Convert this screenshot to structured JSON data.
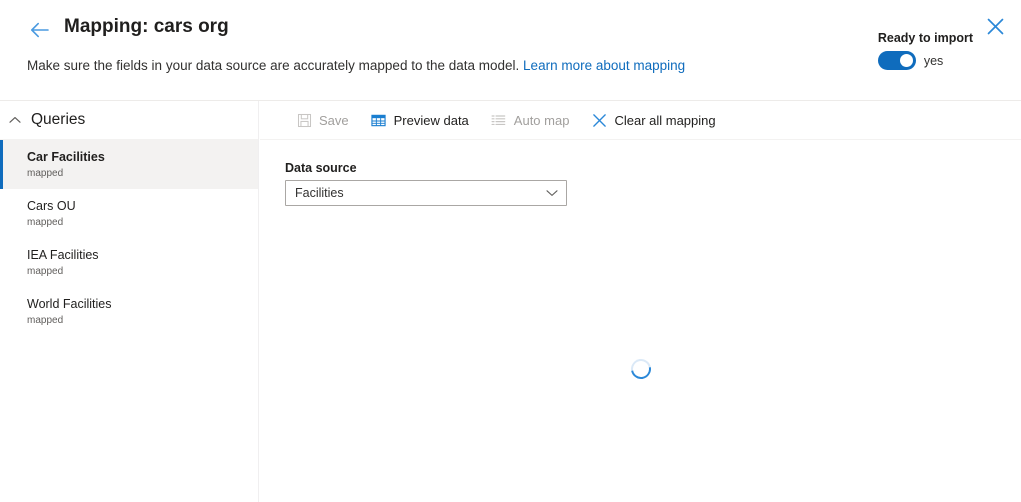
{
  "header": {
    "back_icon": "arrow-left-icon",
    "title": "Mapping: cars org",
    "subtitle_text": "Make sure the fields in your data source are accurately mapped to the data model.",
    "subtitle_link": "Learn more about mapping",
    "ready_label": "Ready to import",
    "toggle_state": "yes",
    "toggle_on": true,
    "close_icon": "close-icon",
    "accent_color": "#0f6cbd"
  },
  "sidebar": {
    "section_title": "Queries",
    "collapse_icon": "chevron-up-icon",
    "items": [
      {
        "label": "Car Facilities",
        "status": "mapped",
        "selected": true
      },
      {
        "label": "Cars OU",
        "status": "mapped",
        "selected": false
      },
      {
        "label": "IEA Facilities",
        "status": "mapped",
        "selected": false
      },
      {
        "label": "World Facilities",
        "status": "mapped",
        "selected": false
      }
    ]
  },
  "toolbar": {
    "buttons": [
      {
        "label": "Save",
        "icon": "save-icon",
        "disabled": true
      },
      {
        "label": "Preview data",
        "icon": "table-icon",
        "disabled": false
      },
      {
        "label": "Auto map",
        "icon": "list-icon",
        "disabled": true
      },
      {
        "label": "Clear all mapping",
        "icon": "close-x-icon",
        "disabled": false
      }
    ]
  },
  "main": {
    "data_source_label": "Data source",
    "data_source_value": "Facilities",
    "dropdown_icon": "chevron-down-icon",
    "loading": true,
    "spinner_color": "#2b88d8"
  }
}
